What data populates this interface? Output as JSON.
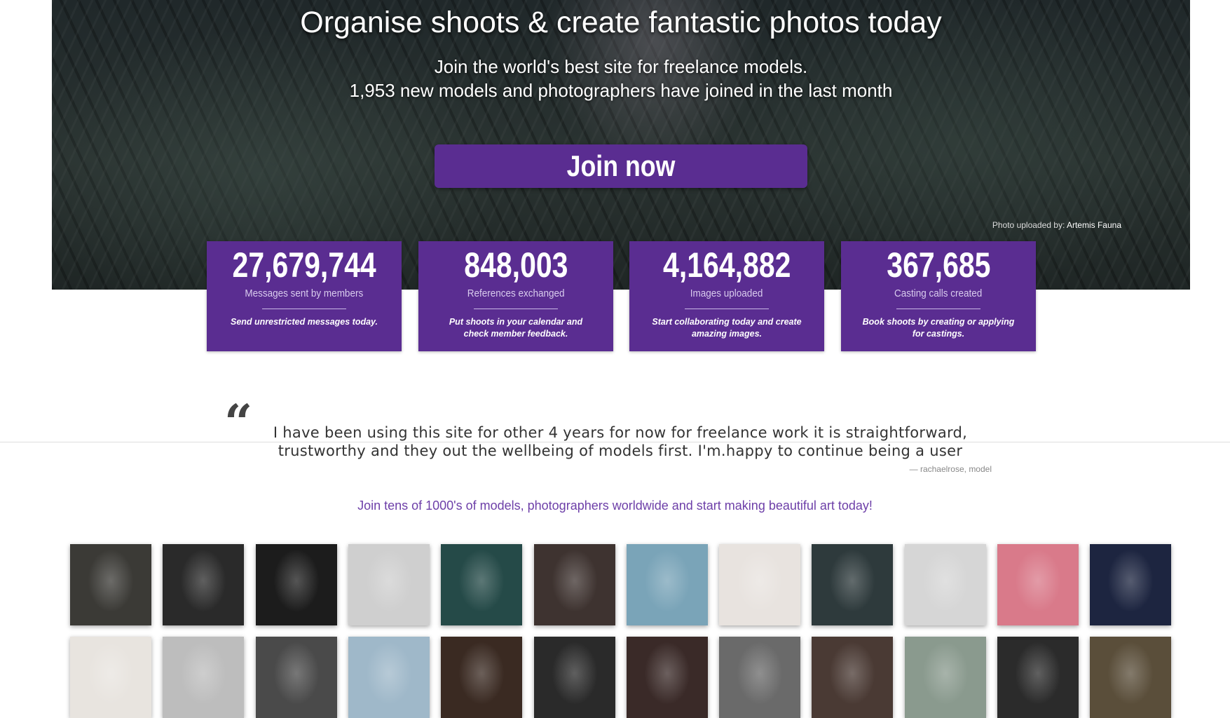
{
  "hero": {
    "headline": "Organise shoots & create fantastic photos today",
    "subline1": "Join the world's best site for freelance models.",
    "subline2": "1,953 new models and photographers have joined in the last month",
    "join_label": "Join now",
    "credit_prefix": "Photo uploaded by:",
    "credit_name": "Artemis Fauna"
  },
  "stats": [
    {
      "number": "27,679,744",
      "label": "Messages sent by members",
      "desc": "Send unrestricted messages today."
    },
    {
      "number": "848,003",
      "label": "References exchanged",
      "desc": "Put shoots in your calendar and check member feedback."
    },
    {
      "number": "4,164,882",
      "label": "Images uploaded",
      "desc": "Start collaborating today and create amazing images."
    },
    {
      "number": "367,685",
      "label": "Casting calls created",
      "desc": "Book shoots by creating or applying for castings."
    }
  ],
  "testimonial": {
    "mark": "“",
    "text": "I have been using this site for other 4 years for now for freelance work it is straightforward, trustworthy and they out the wellbeing of models first. I'm.happy to continue being a user",
    "attribution": "— rachaelrose, model"
  },
  "cta_text": "Join tens of 1000's of models, photographers worldwide and start making beautiful art today!",
  "colors": {
    "brand_purple": "#5a2d91",
    "cta_purple": "#6d3fa8"
  },
  "gallery_rows": [
    [
      "#3b3a36",
      "#2a2a2a",
      "#1c1c1c",
      "#cfcfcf",
      "#254a48",
      "#3e3330",
      "#7aa4b8",
      "#e8e3df",
      "#2e3a3c",
      "#d6d6d6",
      "#d97a8a",
      "#1d2540"
    ],
    [
      "#e8e4df",
      "#bdbdbd",
      "#4a4a4a",
      "#9fb8c9",
      "#3a2a22",
      "#2a2a2a",
      "#3a2a28",
      "#6a6a6a",
      "#4a3a34",
      "#8a9a8e",
      "#2b2b2b",
      "#5a4e3a"
    ]
  ]
}
